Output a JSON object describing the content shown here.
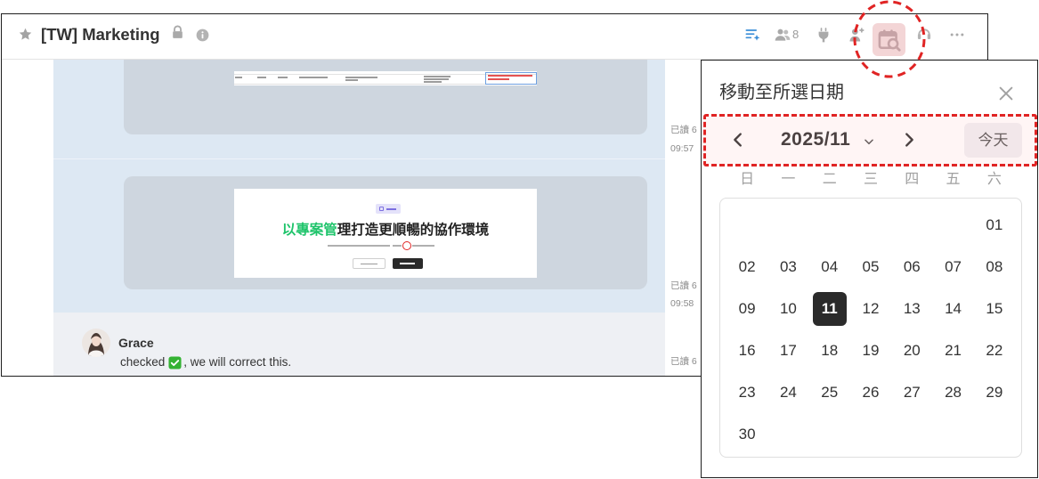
{
  "header": {
    "title": "[TW] Marketing",
    "member_count": "8"
  },
  "messages": [
    {
      "read_status": "已讀 6",
      "time": "09:57"
    },
    {
      "read_status": "已讀 6",
      "time": "09:58"
    },
    {
      "author": "Grace",
      "text_before": "checked",
      "emoji": "check-mark-icon",
      "text_after": ", we will correct this.",
      "read_status": "已讀 6"
    }
  ],
  "attachment": {
    "heading_highlight": "以專案管",
    "heading_rest": "理打造更順暢的協作環境"
  },
  "date_picker": {
    "title": "移動至所選日期",
    "month": "2025/11",
    "today_label": "今天",
    "weekdays": [
      "日",
      "一",
      "二",
      "三",
      "四",
      "五",
      "六"
    ],
    "days": [
      {
        "label": "01"
      },
      {
        "label": "02"
      },
      {
        "label": "03"
      },
      {
        "label": "04"
      },
      {
        "label": "05"
      },
      {
        "label": "06"
      },
      {
        "label": "07"
      },
      {
        "label": "08"
      },
      {
        "label": "09"
      },
      {
        "label": "10"
      },
      {
        "label": "11",
        "selected": true
      },
      {
        "label": "12"
      },
      {
        "label": "13"
      },
      {
        "label": "14"
      },
      {
        "label": "15"
      },
      {
        "label": "16"
      },
      {
        "label": "17"
      },
      {
        "label": "18"
      },
      {
        "label": "19"
      },
      {
        "label": "20"
      },
      {
        "label": "21"
      },
      {
        "label": "22"
      },
      {
        "label": "23"
      },
      {
        "label": "24"
      },
      {
        "label": "25"
      },
      {
        "label": "26"
      },
      {
        "label": "27"
      },
      {
        "label": "28"
      },
      {
        "label": "29"
      },
      {
        "label": "30"
      }
    ]
  },
  "icons": {
    "star": "star-icon",
    "lock": "lock-icon",
    "info": "info-icon",
    "list": "sparkle-list-icon",
    "members": "people-icon",
    "plug": "plug-icon",
    "person": "person-icon",
    "calendar": "calendar-search-icon",
    "headset": "headset-icon",
    "more": "more-icon",
    "close": "close-icon",
    "prev": "chevron-left-icon",
    "next": "chevron-right-icon",
    "dropdown": "chevron-down-icon"
  },
  "colors": {
    "accent": "#3b8ed8",
    "message_bg": "#dde8f3",
    "selected_day": "#2b2b2b",
    "heading_green": "#1fc46b",
    "annotation": "#e02424"
  }
}
